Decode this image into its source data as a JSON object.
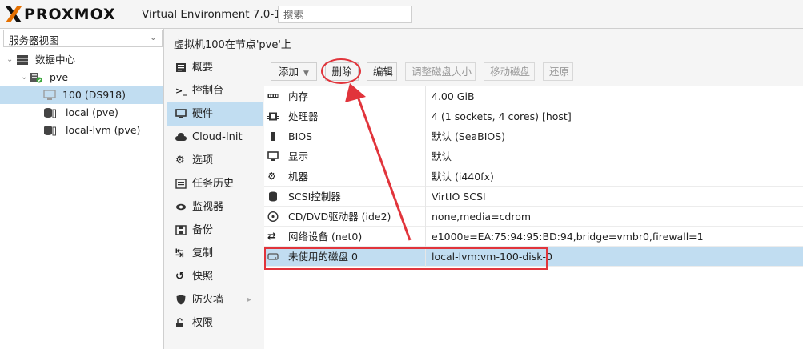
{
  "header": {
    "logo_text": "PROXMOX",
    "version": "Virtual Environment 7.0-11",
    "search_placeholder": "搜索"
  },
  "sidebar": {
    "view_select": "服务器视图",
    "tree": [
      {
        "label": "数据中心",
        "icon": "datacenter-icon",
        "level": 0
      },
      {
        "label": "pve",
        "icon": "server-icon",
        "level": 1
      },
      {
        "label": "100 (DS918)",
        "icon": "vm-icon",
        "level": 2,
        "selected": true
      },
      {
        "label": "local (pve)",
        "icon": "storage-icon",
        "level": 2
      },
      {
        "label": "local-lvm (pve)",
        "icon": "storage-icon",
        "level": 2
      }
    ]
  },
  "panel": {
    "title": "虚拟机100在节点'pve'上",
    "nav": [
      {
        "label": "概要",
        "icon": "summary-icon"
      },
      {
        "label": "控制台",
        "icon": "console-icon"
      },
      {
        "label": "硬件",
        "icon": "hardware-icon",
        "selected": true
      },
      {
        "label": "Cloud-Init",
        "icon": "cloud-icon"
      },
      {
        "label": "选项",
        "icon": "gear-icon"
      },
      {
        "label": "任务历史",
        "icon": "list-icon"
      },
      {
        "label": "监视器",
        "icon": "eye-icon"
      },
      {
        "label": "备份",
        "icon": "floppy-icon"
      },
      {
        "label": "复制",
        "icon": "retweet-icon"
      },
      {
        "label": "快照",
        "icon": "history-icon"
      },
      {
        "label": "防火墙",
        "icon": "shield-icon",
        "has_submenu": true
      },
      {
        "label": "权限",
        "icon": "unlock-icon"
      }
    ],
    "toolbar": {
      "add": "添加",
      "remove": "删除",
      "edit": "编辑",
      "resize": "调整磁盘大小",
      "move": "移动磁盘",
      "revert": "还原"
    },
    "hardware": [
      {
        "name": "内存",
        "value": "4.00 GiB",
        "icon": "memory-icon"
      },
      {
        "name": "处理器",
        "value": "4 (1 sockets, 4 cores) [host]",
        "icon": "cpu-icon"
      },
      {
        "name": "BIOS",
        "value": "默认 (SeaBIOS)",
        "icon": "microchip-icon"
      },
      {
        "name": "显示",
        "value": "默认",
        "icon": "desktop-icon"
      },
      {
        "name": "机器",
        "value": "默认 (i440fx)",
        "icon": "cogs-icon"
      },
      {
        "name": "SCSI控制器",
        "value": "VirtIO SCSI",
        "icon": "database-icon"
      },
      {
        "name": "CD/DVD驱动器 (ide2)",
        "value": "none,media=cdrom",
        "icon": "cdrom-icon"
      },
      {
        "name": "网络设备 (net0)",
        "value": "e1000e=EA:75:94:95:BD:94,bridge=vmbr0,firewall=1",
        "icon": "exchange-icon"
      },
      {
        "name": "未使用的磁盘 0",
        "value": "local-lvm:vm-100-disk-0",
        "icon": "hdd-icon",
        "selected": true
      }
    ]
  },
  "colors": {
    "selection": "#c1ddf1",
    "annotation": "#e1343b",
    "logo_orange": "#e57000"
  }
}
